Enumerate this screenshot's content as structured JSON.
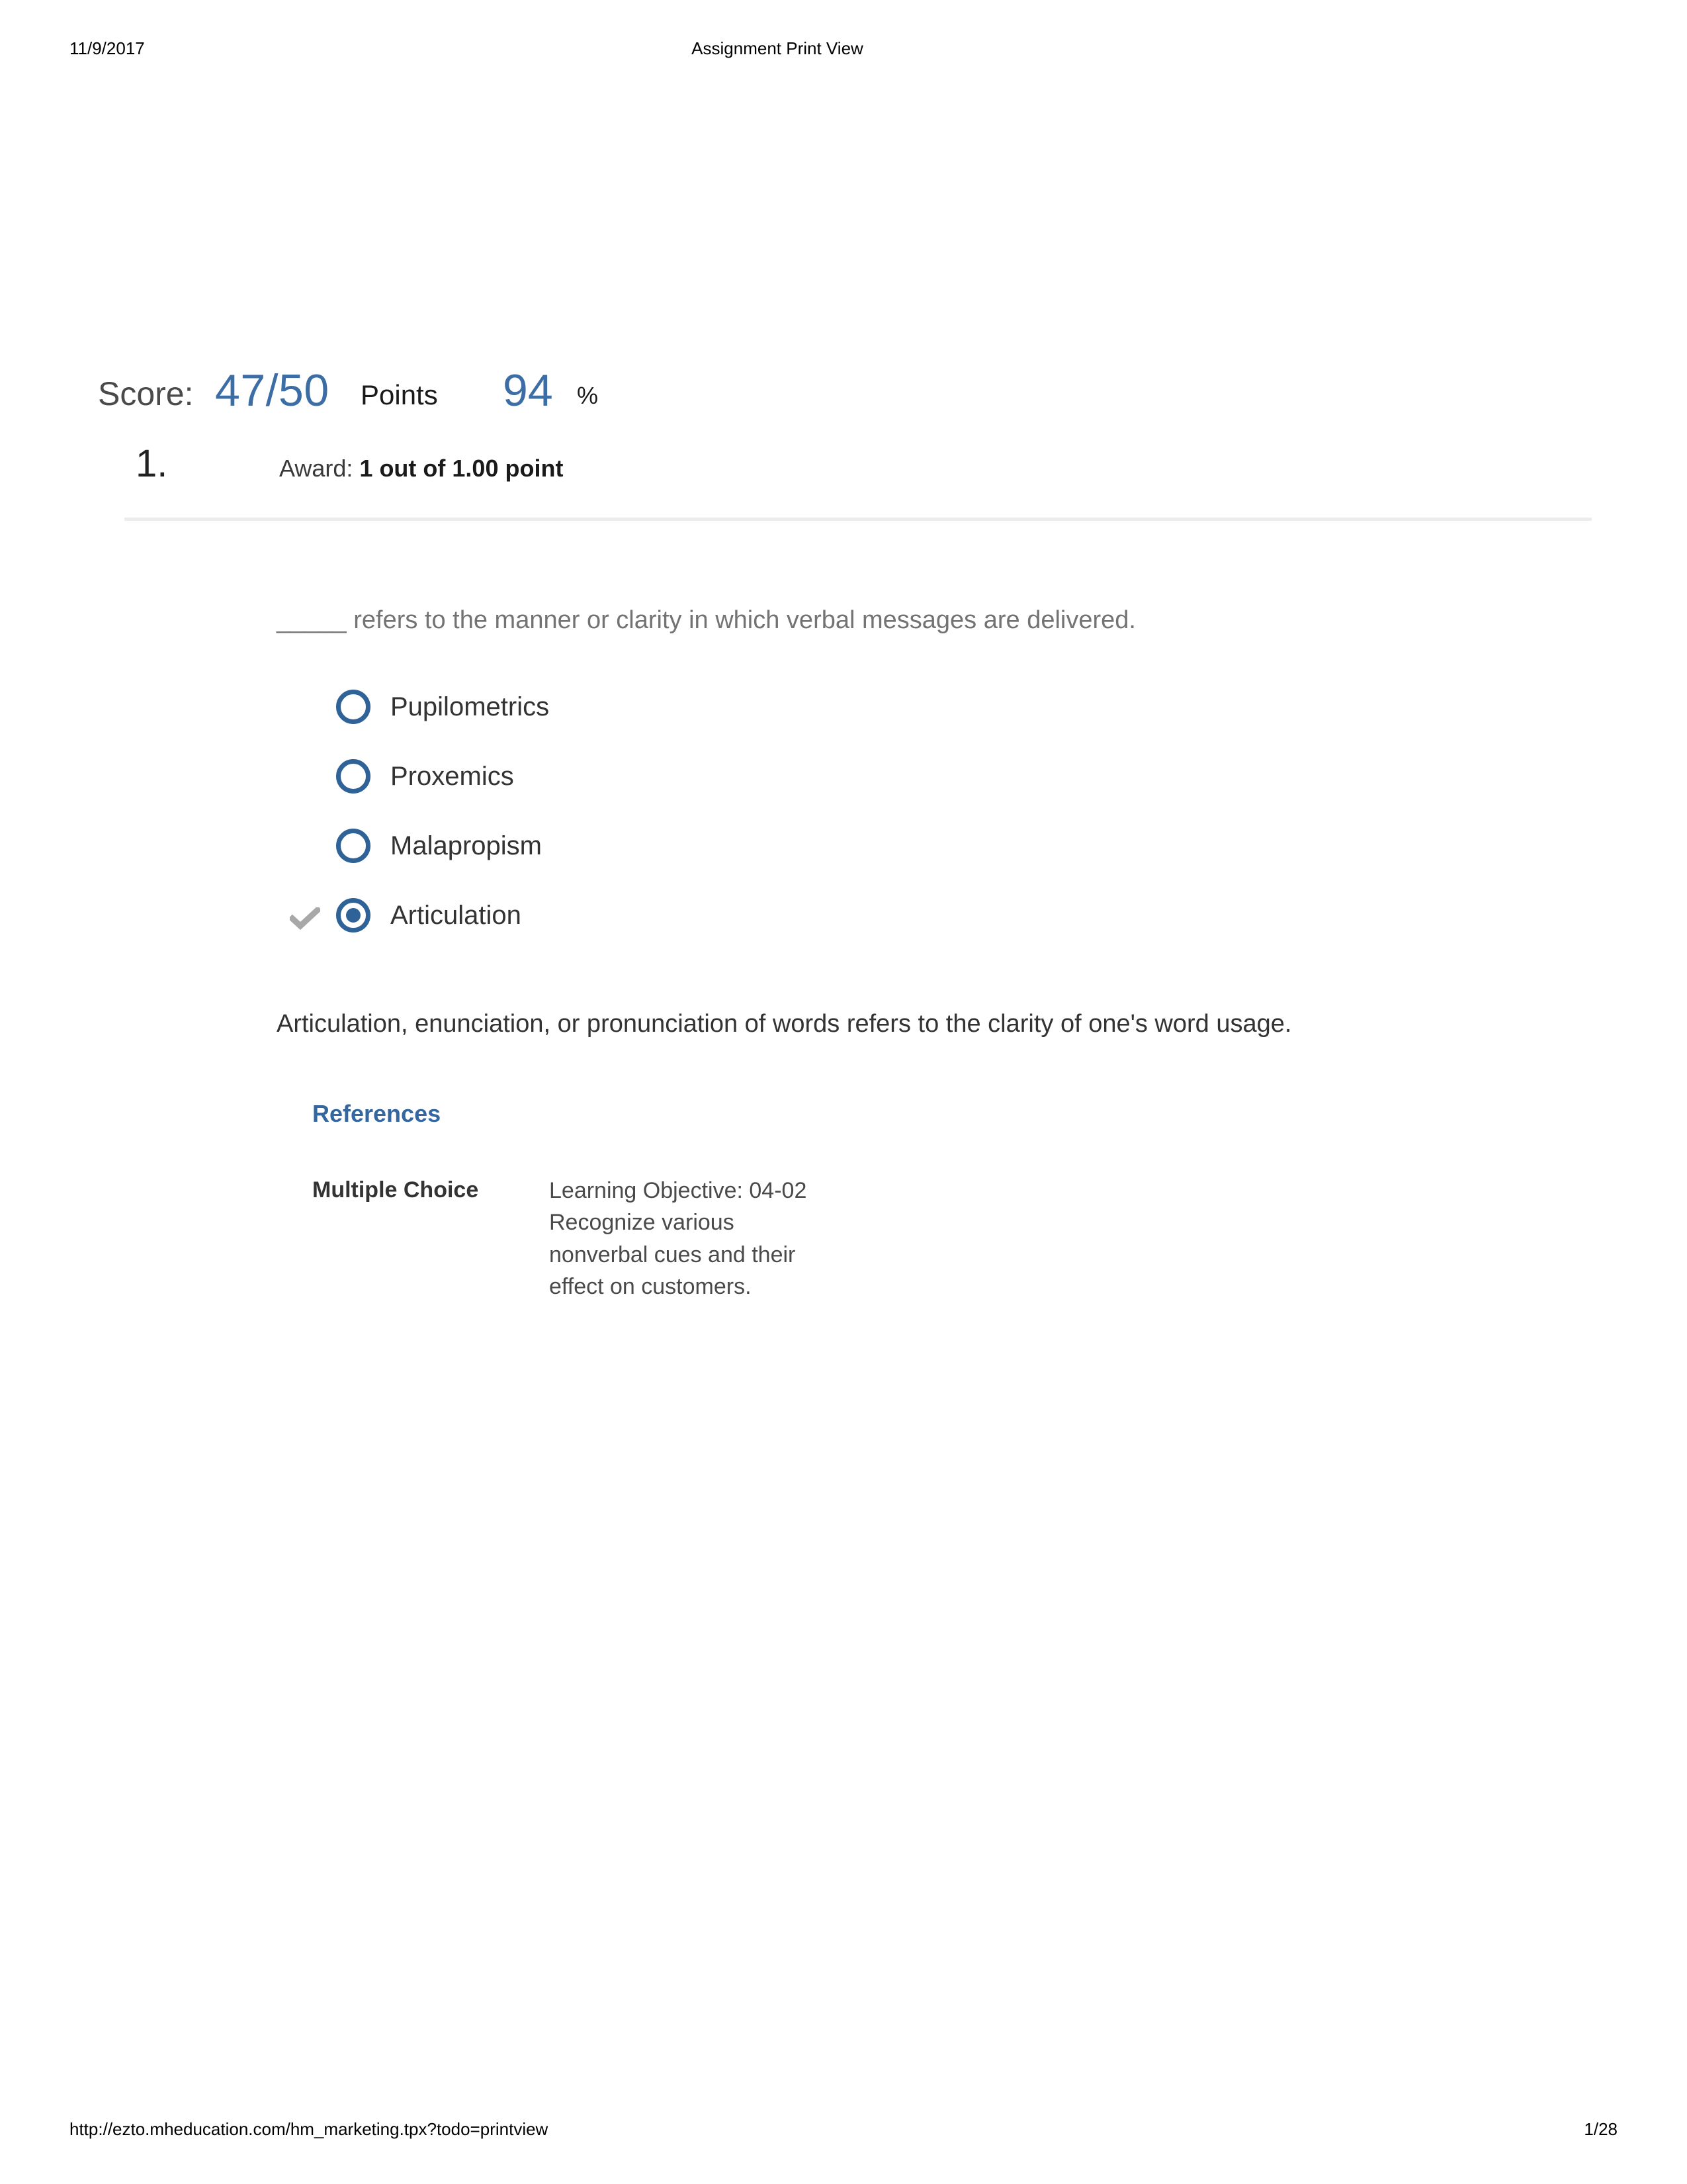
{
  "page_header": {
    "date": "11/9/2017",
    "title": "Assignment Print View"
  },
  "page_footer": {
    "url": "http://ezto.mheducation.com/hm_marketing.tpx?todo=printview",
    "page_indicator": "1/28"
  },
  "score": {
    "label": "Score:",
    "value": "47/50",
    "points_label": "Points",
    "percent": "94",
    "percent_symbol": "%",
    "accent_color": "#3c6da4"
  },
  "question": {
    "number": "1.",
    "award_label": "Award:",
    "award_value": "1 out of 1.00 point",
    "stem": "_____ refers to the manner or clarity in which verbal messages are delivered.",
    "options": [
      {
        "label": "Pupilometrics",
        "selected": false,
        "correct_mark": false
      },
      {
        "label": "Proxemics",
        "selected": false,
        "correct_mark": false
      },
      {
        "label": "Malapropism",
        "selected": false,
        "correct_mark": false
      },
      {
        "label": "Articulation",
        "selected": true,
        "correct_mark": true
      }
    ],
    "explanation": "Articulation, enunciation, or pronunciation of words refers to the clarity of one's word usage.",
    "references_heading": "References",
    "meta": {
      "question_type": "Multiple Choice",
      "learning_objective": "Learning Objective: 04-02 Recognize various nonverbal cues and their effect on customers."
    },
    "radio_color": "#2f6296",
    "check_color": "#a8a8a8"
  }
}
